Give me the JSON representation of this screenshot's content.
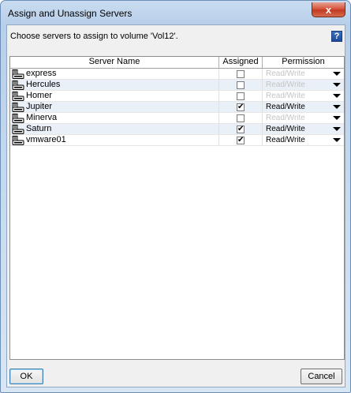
{
  "window": {
    "title": "Assign and Unassign Servers",
    "close_label": "x"
  },
  "prompt": "Choose servers to assign to volume 'Vol12'.",
  "help_label": "?",
  "table": {
    "columns": [
      "Server Name",
      "Assigned",
      "Permission"
    ],
    "rows": [
      {
        "name": "express",
        "assigned": false,
        "permission": "Read/Write",
        "enabled": false
      },
      {
        "name": "Hercules",
        "assigned": false,
        "permission": "Read/Write",
        "enabled": false
      },
      {
        "name": "Homer",
        "assigned": false,
        "permission": "Read/Write",
        "enabled": false
      },
      {
        "name": "Jupiter",
        "assigned": true,
        "permission": "Read/Write",
        "enabled": true
      },
      {
        "name": "Minerva",
        "assigned": false,
        "permission": "Read/Write",
        "enabled": false
      },
      {
        "name": "Saturn",
        "assigned": true,
        "permission": "Read/Write",
        "enabled": true
      },
      {
        "name": "vmware01",
        "assigned": true,
        "permission": "Read/Write",
        "enabled": true
      }
    ]
  },
  "buttons": {
    "ok": "OK",
    "cancel": "Cancel"
  },
  "icons": {
    "server": "server-icon",
    "help": "help-icon",
    "close": "close-icon",
    "dropdown": "chevron-down-icon"
  }
}
